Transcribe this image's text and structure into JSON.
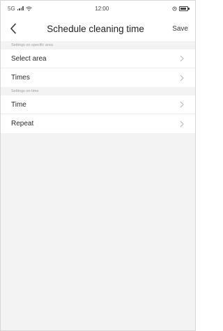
{
  "status_bar": {
    "time": "12:00",
    "carrier_signal": "5G"
  },
  "nav": {
    "title": "Schedule cleaning time",
    "save_label": "Save",
    "back_icon": "chevron-left-icon"
  },
  "sections": [
    {
      "header": "Settings on specific area",
      "rows": [
        {
          "label": "Select area"
        },
        {
          "label": "Times"
        }
      ]
    },
    {
      "header": "Settings on time",
      "rows": [
        {
          "label": "Time"
        },
        {
          "label": "Repeat"
        }
      ]
    }
  ],
  "colors": {
    "page_bg": "#f3f3f3",
    "row_bg": "#ffffff",
    "chevron": "#b5b5b5"
  }
}
